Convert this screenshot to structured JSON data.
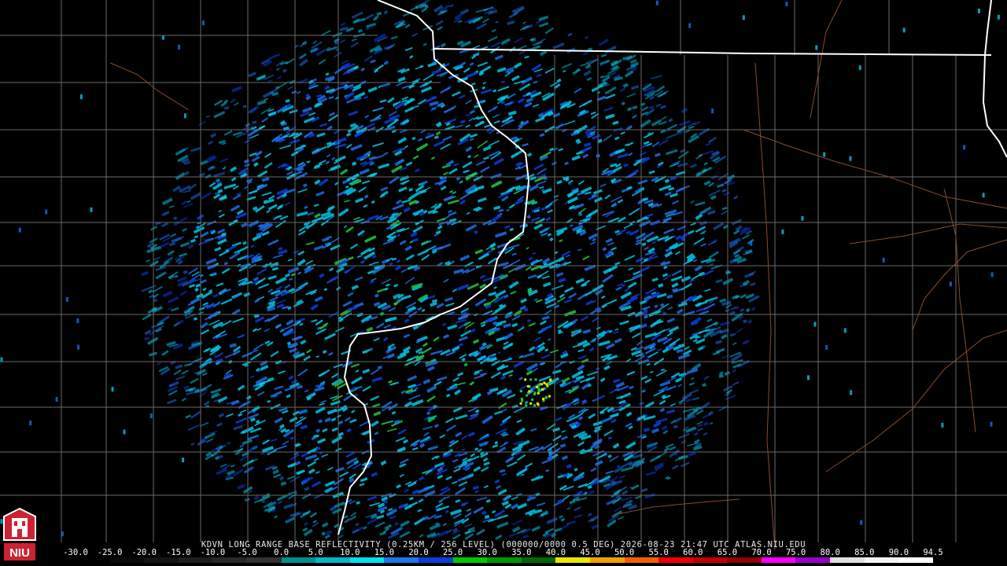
{
  "radar": {
    "site": "KDVN",
    "caption": "KDVN LONG RANGE BASE REFLECTIVITY (0.25KM / 256 LEVEL) (000000/0000 0.5 DEG) 2026-08-23 21:47 UTC  ATLAS.NIU.EDU"
  },
  "logo": {
    "text": "NIU"
  },
  "scale": {
    "ticks": [
      "-30.0",
      "-25.0",
      "-20.0",
      "-15.0",
      "-10.0",
      "-5.0",
      "0.0",
      "5.0",
      "10.0",
      "15.0",
      "20.0",
      "25.0",
      "30.0",
      "35.0",
      "40.0",
      "45.0",
      "50.0",
      "55.0",
      "60.0",
      "65.0",
      "70.0",
      "75.0",
      "80.0",
      "85.0",
      "90.0",
      "94.5"
    ],
    "colors": [
      "#000000",
      "#0a0a0a",
      "#141414",
      "#1e1e1e",
      "#282828",
      "#323232",
      "#008f8f",
      "#00b8c8",
      "#00e0f0",
      "#1a78e8",
      "#0a3cd8",
      "#00c800",
      "#009800",
      "#006800",
      "#e8e800",
      "#f0a000",
      "#f06000",
      "#f00000",
      "#c00000",
      "#900000",
      "#ff00ff",
      "#9800c8",
      "#e0e0e0",
      "#f4f4f4",
      "#ffffff"
    ]
  },
  "colors": {
    "background": "#000000",
    "county_lines": "#6a6a6a",
    "state_lines": "#ffffff",
    "highways": "#8a4a2a",
    "echo_cyan": "#00c8e8",
    "echo_blue": "#1a6ee8",
    "echo_deep_blue": "#0a3cd8",
    "echo_green": "#22c840",
    "echo_yellow": "#e8e800"
  }
}
